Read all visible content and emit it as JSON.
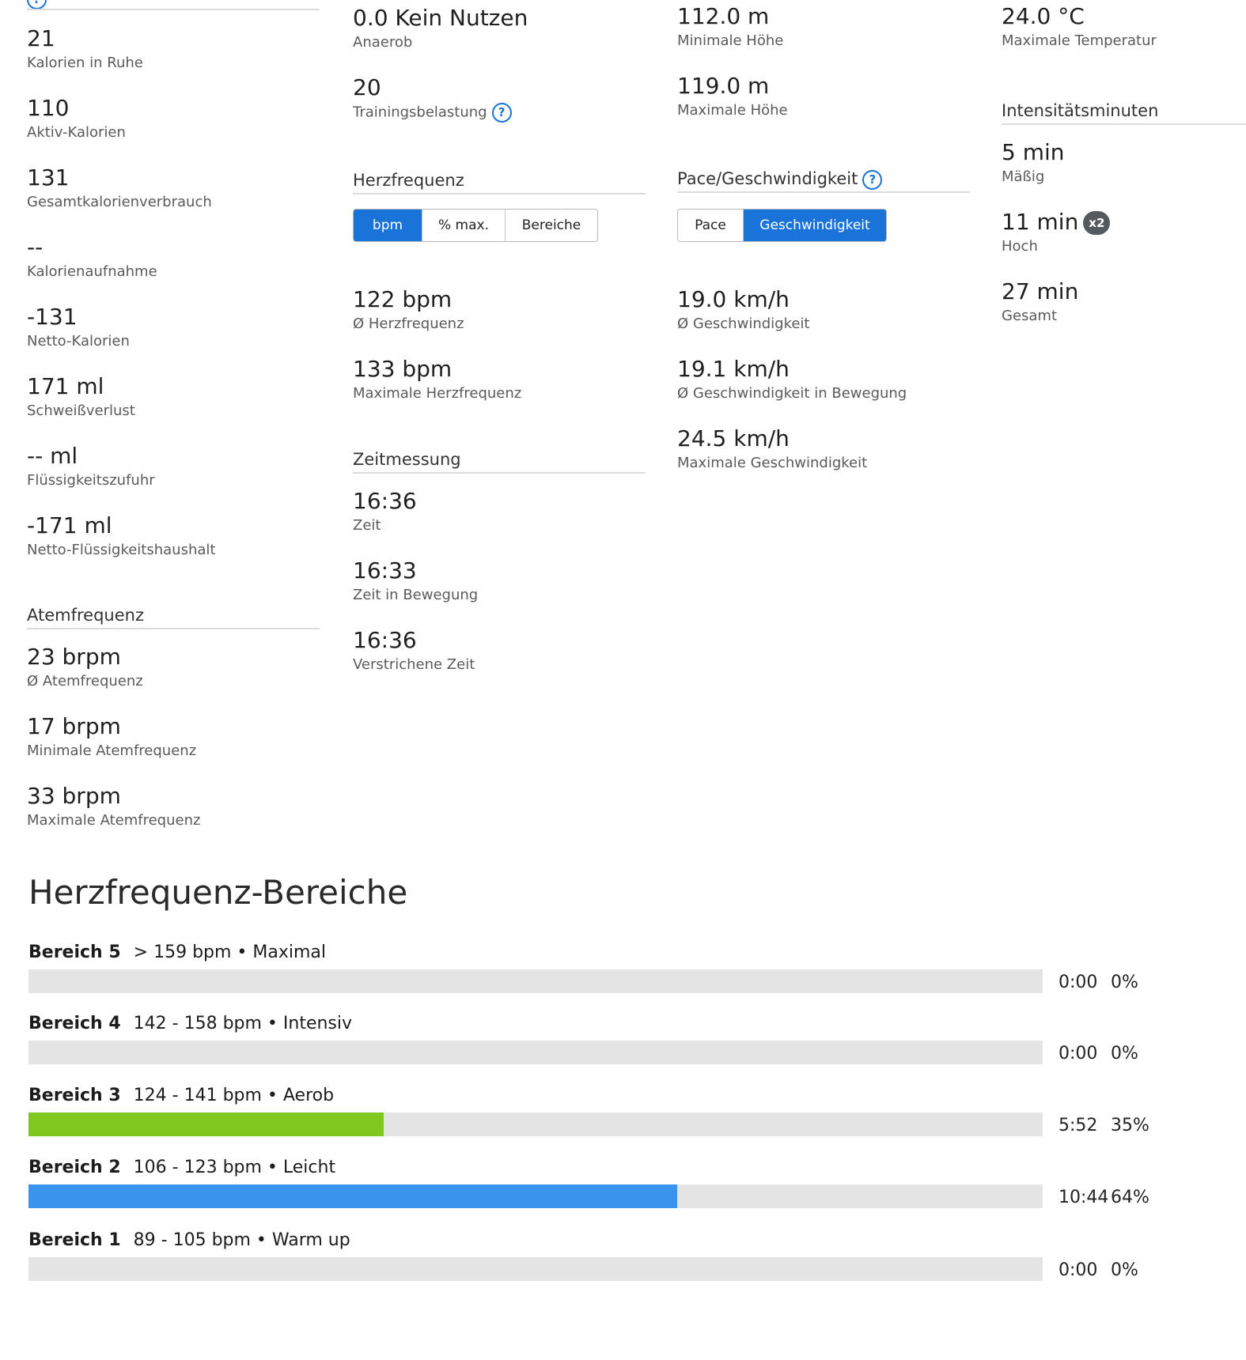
{
  "col1": {
    "stats": [
      {
        "value": "21",
        "label": "Kalorien in Ruhe"
      },
      {
        "value": "110",
        "label": "Aktiv-Kalorien"
      },
      {
        "value": "131",
        "label": "Gesamtkalorienverbrauch"
      },
      {
        "value": "--",
        "label": "Kalorienaufnahme"
      },
      {
        "value": "-131",
        "label": "Netto-Kalorien"
      },
      {
        "value": "171 ml",
        "label": "Schweißverlust"
      },
      {
        "value": "-- ml",
        "label": "Flüssigkeitszufuhr"
      },
      {
        "value": "-171 ml",
        "label": "Netto-Flüssigkeitshaushalt"
      }
    ],
    "breath_title": "Atemfrequenz",
    "breath": [
      {
        "value": "23 brpm",
        "label": "Ø Atemfrequenz"
      },
      {
        "value": "17 brpm",
        "label": "Minimale Atemfrequenz"
      },
      {
        "value": "33 brpm",
        "label": "Maximale Atemfrequenz"
      }
    ]
  },
  "col2": {
    "stats": [
      {
        "value": "0.0 Kein Nutzen",
        "label": "Anaerob"
      },
      {
        "value": "20",
        "label": "Trainingsbelastung"
      }
    ],
    "help_glyph": "?",
    "hr_title": "Herzfrequenz",
    "hr_tabs": [
      "bpm",
      "% max.",
      "Bereiche"
    ],
    "hr_active_tab": 0,
    "hr": [
      {
        "value": "122 bpm",
        "label": "Ø Herzfrequenz"
      },
      {
        "value": "133 bpm",
        "label": "Maximale Herzfrequenz"
      }
    ],
    "time_title": "Zeitmessung",
    "time": [
      {
        "value": "16:36",
        "label": "Zeit"
      },
      {
        "value": "16:33",
        "label": "Zeit in Bewegung"
      },
      {
        "value": "16:36",
        "label": "Verstrichene Zeit"
      }
    ]
  },
  "col3": {
    "stats": [
      {
        "value": "112.0 m",
        "label": "Minimale Höhe"
      },
      {
        "value": "119.0 m",
        "label": "Maximale Höhe"
      }
    ],
    "pace_title": "Pace/Geschwindigkeit",
    "pace_tabs": [
      "Pace",
      "Geschwindigkeit"
    ],
    "pace_active_tab": 1,
    "speed": [
      {
        "value": "19.0 km/h",
        "label": "Ø Geschwindigkeit"
      },
      {
        "value": "19.1 km/h",
        "label": "Ø Geschwindigkeit in Bewegung"
      },
      {
        "value": "24.5 km/h",
        "label": "Maximale Geschwindigkeit"
      }
    ]
  },
  "col4": {
    "stats": [
      {
        "value": "24.0 °C",
        "label": "Maximale Temperatur"
      }
    ],
    "intensity_title": "Intensitätsminuten",
    "intensity": [
      {
        "value": "5 min",
        "label": "Mäßig"
      },
      {
        "value": "11 min",
        "label": "Hoch",
        "badge": "x2"
      },
      {
        "value": "27 min",
        "label": "Gesamt"
      }
    ]
  },
  "zones": {
    "title": "Herzfrequenz-Bereiche",
    "items": [
      {
        "name": "Bereich 5",
        "range": "> 159 bpm • Maximal",
        "time": "0:00",
        "percent": "0%",
        "fill_fraction": 0,
        "color": "#e4e4e4"
      },
      {
        "name": "Bereich 4",
        "range": "142 - 158 bpm • Intensiv",
        "time": "0:00",
        "percent": "0%",
        "fill_fraction": 0,
        "color": "#e4e4e4"
      },
      {
        "name": "Bereich 3",
        "range": "124 - 141 bpm • Aerob",
        "time": "5:52",
        "percent": "35%",
        "fill_fraction": 0.35,
        "color": "#7ec81f"
      },
      {
        "name": "Bereich 2",
        "range": "106 - 123 bpm • Leicht",
        "time": "10:44",
        "percent": "64%",
        "fill_fraction": 0.64,
        "color": "#3a93ec"
      },
      {
        "name": "Bereich 1",
        "range": "89 - 105 bpm • Warm up",
        "time": "0:00",
        "percent": "0%",
        "fill_fraction": 0,
        "color": "#e4e4e4"
      }
    ]
  }
}
